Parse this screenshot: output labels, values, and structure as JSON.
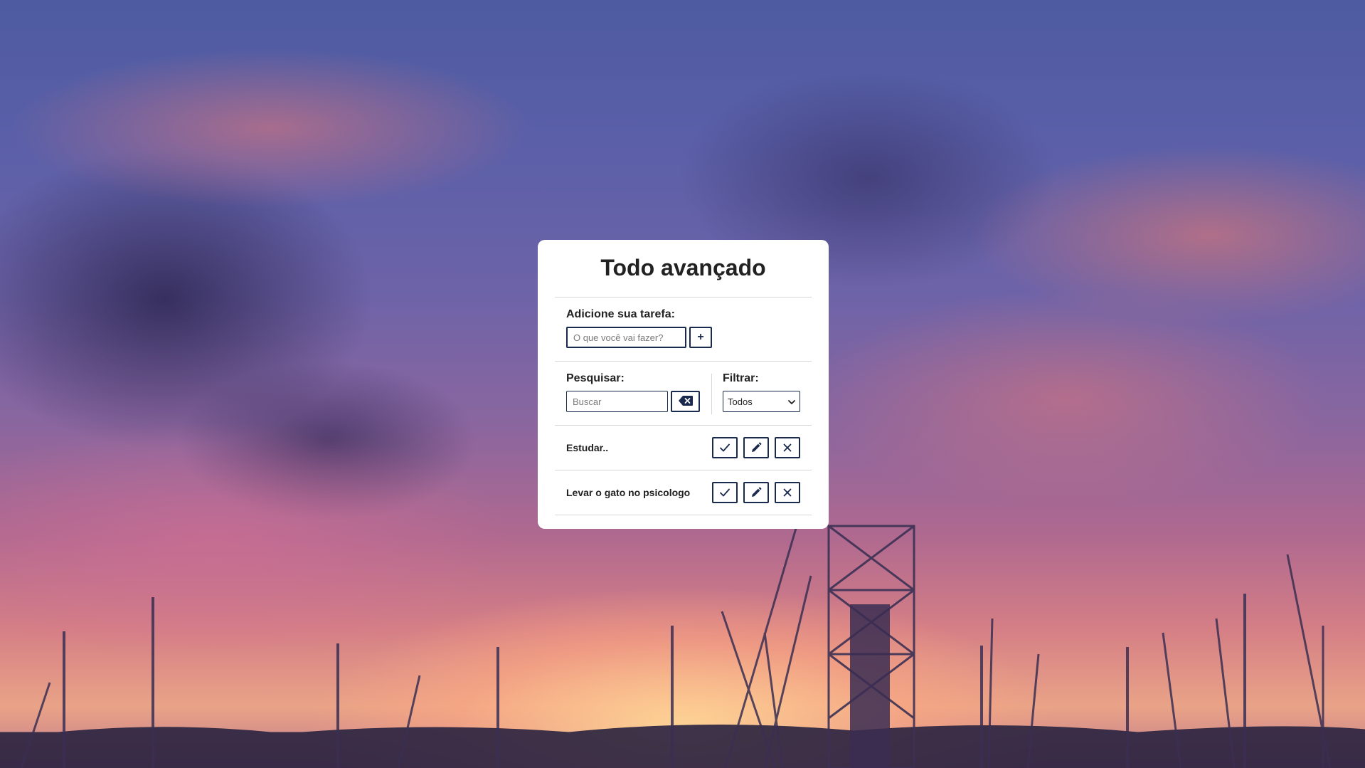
{
  "app": {
    "title": "Todo avançado"
  },
  "add_form": {
    "label": "Adicione sua tarefa:",
    "input_placeholder": "O que você vai fazer?",
    "input_value": "",
    "add_button_label": "+"
  },
  "search": {
    "label": "Pesquisar:",
    "placeholder": "Buscar",
    "value": "",
    "erase_icon": "backspace-icon"
  },
  "filter": {
    "label": "Filtrar:",
    "selected": "Todos",
    "arrow_icon": "chevron-down-icon"
  },
  "todos": [
    {
      "text": "Estudar..",
      "actions": [
        "check-icon",
        "pencil-icon",
        "close-icon"
      ]
    },
    {
      "text": "Levar o gato no psicologo",
      "actions": [
        "check-icon",
        "pencil-icon",
        "close-icon"
      ]
    }
  ],
  "colors": {
    "accent": "#1a2a4e",
    "card_background": "#ffffff",
    "text": "#222222",
    "divider": "#d6d6d6"
  }
}
